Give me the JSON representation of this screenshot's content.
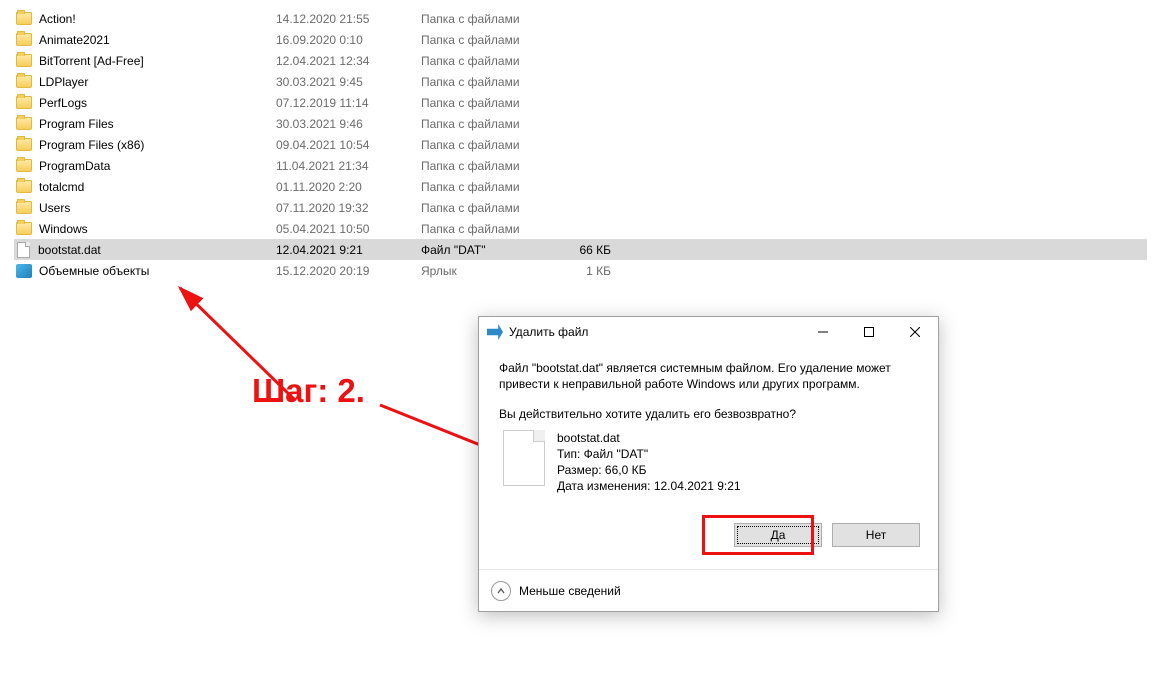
{
  "step_label": "Шаг: 2.",
  "files": [
    {
      "name": "Action!",
      "date": "14.12.2020 21:55",
      "type": "Папка с файлами",
      "size": "",
      "icon": "folder"
    },
    {
      "name": "Animate2021",
      "date": "16.09.2020 0:10",
      "type": "Папка с файлами",
      "size": "",
      "icon": "folder"
    },
    {
      "name": "BitTorrent [Ad-Free]",
      "date": "12.04.2021 12:34",
      "type": "Папка с файлами",
      "size": "",
      "icon": "folder"
    },
    {
      "name": "LDPlayer",
      "date": "30.03.2021 9:45",
      "type": "Папка с файлами",
      "size": "",
      "icon": "folder"
    },
    {
      "name": "PerfLogs",
      "date": "07.12.2019 11:14",
      "type": "Папка с файлами",
      "size": "",
      "icon": "folder"
    },
    {
      "name": "Program Files",
      "date": "30.03.2021 9:46",
      "type": "Папка с файлами",
      "size": "",
      "icon": "folder"
    },
    {
      "name": "Program Files (x86)",
      "date": "09.04.2021 10:54",
      "type": "Папка с файлами",
      "size": "",
      "icon": "folder"
    },
    {
      "name": "ProgramData",
      "date": "11.04.2021 21:34",
      "type": "Папка с файлами",
      "size": "",
      "icon": "folder"
    },
    {
      "name": "totalcmd",
      "date": "01.11.2020 2:20",
      "type": "Папка с файлами",
      "size": "",
      "icon": "folder"
    },
    {
      "name": "Users",
      "date": "07.11.2020 19:32",
      "type": "Папка с файлами",
      "size": "",
      "icon": "folder"
    },
    {
      "name": "Windows",
      "date": "05.04.2021 10:50",
      "type": "Папка с файлами",
      "size": "",
      "icon": "folder"
    },
    {
      "name": "bootstat.dat",
      "date": "12.04.2021 9:21",
      "type": "Файл \"DAT\"",
      "size": "66 КБ",
      "icon": "file",
      "selected": true
    },
    {
      "name": "Объемные объекты",
      "date": "15.12.2020 20:19",
      "type": "Ярлык",
      "size": "1 КБ",
      "icon": "3d"
    }
  ],
  "dialog": {
    "title": "Удалить файл",
    "warning": "Файл \"bootstat.dat\" является системным файлом. Его удаление может привести к неправильной работе Windows или других программ.",
    "question": "Вы действительно хотите удалить его безвозвратно?",
    "file": {
      "name": "bootstat.dat",
      "type_line": "Тип: Файл \"DAT\"",
      "size_line": "Размер: 66,0 КБ",
      "date_line": "Дата изменения: 12.04.2021 9:21"
    },
    "yes": "Да",
    "no": "Нет",
    "less": "Меньше сведений"
  }
}
